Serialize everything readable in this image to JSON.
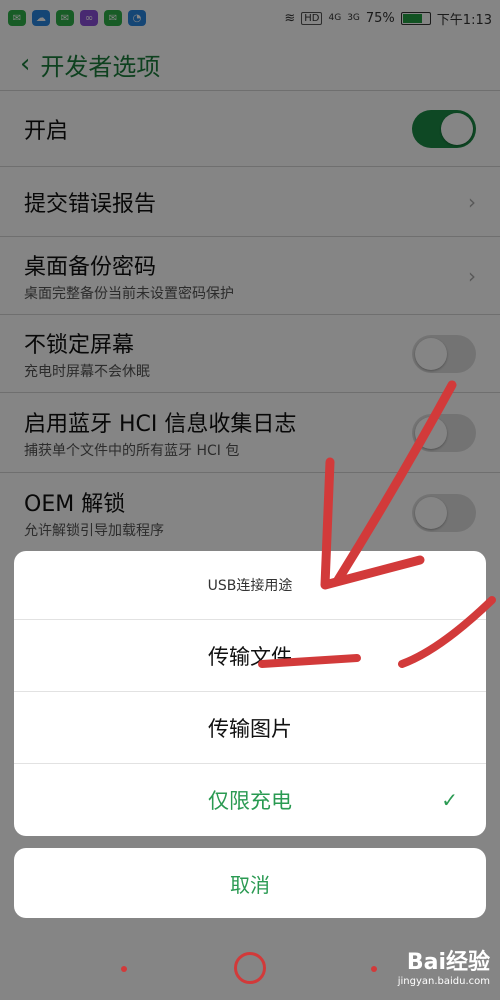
{
  "status_bar": {
    "apps": [
      "wechat-icon",
      "cloud-icon",
      "wechat-icon",
      "infinity-icon",
      "wechat-icon",
      "timer-icon"
    ],
    "hd": "HD",
    "signal1": "4G",
    "signal2": "3G",
    "battery_percent": "75%",
    "battery_level": 0.75,
    "time": "下午1:13"
  },
  "header": {
    "title": "开发者选项"
  },
  "rows": [
    {
      "title": "开启",
      "toggle": "on"
    },
    {
      "title": "提交错误报告",
      "chevron": true
    },
    {
      "title": "桌面备份密码",
      "sub": "桌面完整备份当前未设置密码保护",
      "chevron": true
    },
    {
      "title": "不锁定屏幕",
      "sub": "充电时屏幕不会休眠",
      "toggle": "off"
    },
    {
      "title": "启用蓝牙 HCI 信息收集日志",
      "sub": "捕获单个文件中的所有蓝牙 HCI 包",
      "toggle": "off"
    },
    {
      "title": "OEM 解锁",
      "sub": "允许解锁引导加载程序",
      "toggle": "off"
    }
  ],
  "dialog": {
    "title": "USB连接用途",
    "options": [
      {
        "label": "传输文件",
        "selected": false
      },
      {
        "label": "传输图片",
        "selected": false
      },
      {
        "label": "仅限充电",
        "selected": true
      }
    ]
  },
  "cancel_label": "取消",
  "watermark": {
    "brand": "Bai经验",
    "url": "jingyan.baidu.com"
  },
  "colors": {
    "accent": "#2a9a52",
    "annotation": "#d23a3a"
  }
}
